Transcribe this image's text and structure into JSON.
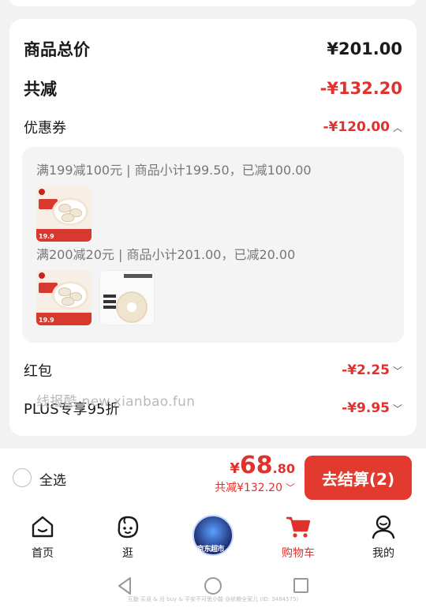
{
  "summary": {
    "total_label": "商品总价",
    "total_value": "¥201.00",
    "reduce_label": "共减",
    "reduce_value": "-¥132.20",
    "coupon_label": "优惠券",
    "coupon_value": "-¥120.00"
  },
  "coupons": [
    {
      "condition": "满199减100元 | 商品小计199.50，已减100.00",
      "product_price": "19.9"
    },
    {
      "condition": "满200减20元 | 商品小计201.00，已减20.00",
      "product_price": "19.9"
    }
  ],
  "hongbao": {
    "label": "红包",
    "value": "-¥2.25"
  },
  "plus": {
    "label": "PLUS专享95折",
    "value": "-¥9.95"
  },
  "watermark": "线报酷 new.xianbao.fun",
  "checkout": {
    "select_all": "全选",
    "currency": "¥",
    "amount_int": "68",
    "amount_dec": ".80",
    "reduced": "共减¥132.20",
    "pay_button": "去结算(2)"
  },
  "tabs": [
    {
      "label": "首页",
      "icon": "home-icon"
    },
    {
      "label": "逛",
      "icon": "face-icon"
    },
    {
      "label": "",
      "icon": "promo-badge-icon"
    },
    {
      "label": "购物车",
      "icon": "cart-icon",
      "active": true
    },
    {
      "label": "我的",
      "icon": "person-icon"
    }
  ],
  "center_badge_text": "京东超市",
  "footer_note": "互動 买返 & 沿 buy & 平安不可思小能 @依赖全家儿 (ID: 3484575)",
  "colors": {
    "accent": "#e0312c",
    "pay_button": "#e23a2e",
    "background": "#f2f2f2"
  }
}
